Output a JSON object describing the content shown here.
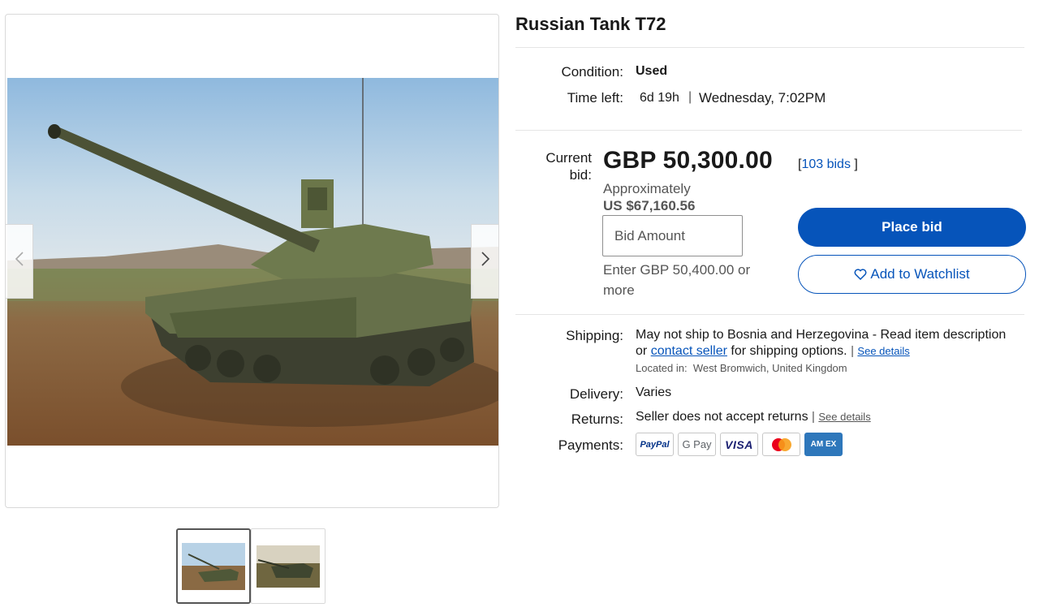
{
  "listing": {
    "title": "Russian Tank T72"
  },
  "details": {
    "condition_label": "Condition:",
    "condition_value": "Used",
    "time_left_label": "Time left:",
    "time_left_value": "6d 19h",
    "time_left_sep": "|",
    "end_time": "Wednesday, 7:02PM"
  },
  "bidding": {
    "current_bid_label_1": "Current",
    "current_bid_label_2": "bid:",
    "price": "GBP 50,300.00",
    "bids_open": "[",
    "bids_count": "103 bids",
    "bids_close": "]",
    "approx_label": "Approximately",
    "approx_value": "US $67,160.56",
    "bid_placeholder": "Bid Amount",
    "bid_hint": "Enter GBP 50,400.00 or more",
    "place_bid": "Place bid",
    "add_watchlist": "Add to Watchlist"
  },
  "shipping": {
    "shipping_label": "Shipping:",
    "shipping_text_1": "May not ship to Bosnia and Herzegovina - Read item description or",
    "contact_seller": "contact seller",
    "shipping_text_2": "for shipping options.",
    "sep": "|",
    "see_details": "See details",
    "located_label": "Located in:",
    "located_value": "West Bromwich, United Kingdom",
    "delivery_label": "Delivery:",
    "delivery_value": "Varies",
    "returns_label": "Returns:",
    "returns_value": "Seller does not accept returns",
    "returns_sep": "|",
    "returns_see_details": "See details",
    "payments_label": "Payments:"
  },
  "payments": {
    "paypal": "PayPal",
    "gpay": "G Pay",
    "visa": "VISA",
    "amex": "AM EX"
  },
  "gallery": {
    "prev_icon": "chevron-left-icon",
    "next_icon": "chevron-right-icon",
    "thumb_count": 2
  },
  "colors": {
    "accent": "#0654ba",
    "text": "#191919",
    "muted": "#555555",
    "border": "#d9d9d9"
  }
}
